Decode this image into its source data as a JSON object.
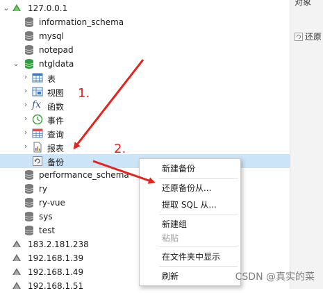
{
  "tree": {
    "server": "127.0.0.1",
    "databases": [
      {
        "name": "information_schema"
      },
      {
        "name": "mysql"
      },
      {
        "name": "notepad"
      }
    ],
    "open_db": "ntgldata",
    "objects": [
      "表",
      "视图",
      "函数",
      "事件",
      "查询",
      "报表",
      "备份"
    ],
    "more_databases": [
      "performance_schema",
      "ry",
      "ry-vue",
      "sys",
      "test"
    ],
    "other_servers": [
      "183.2.181.238",
      "192.168.1.39",
      "192.168.1.49",
      "192.168.1.51"
    ]
  },
  "right_panel": {
    "top_text": "对象",
    "restore_label": "还原"
  },
  "context_menu": {
    "items": [
      "新建备份",
      "还原备份从...",
      "提取 SQL 从...",
      "新建组",
      "粘贴",
      "在文件夹中显示",
      "刷新"
    ]
  },
  "annotations": {
    "step1": "1.",
    "step2": "2."
  },
  "watermark": "CSDN @真实的菜",
  "colors": {
    "selection": "#cce4f7",
    "annotation": "#e8211a",
    "server_icon": "#3a9b3a"
  }
}
